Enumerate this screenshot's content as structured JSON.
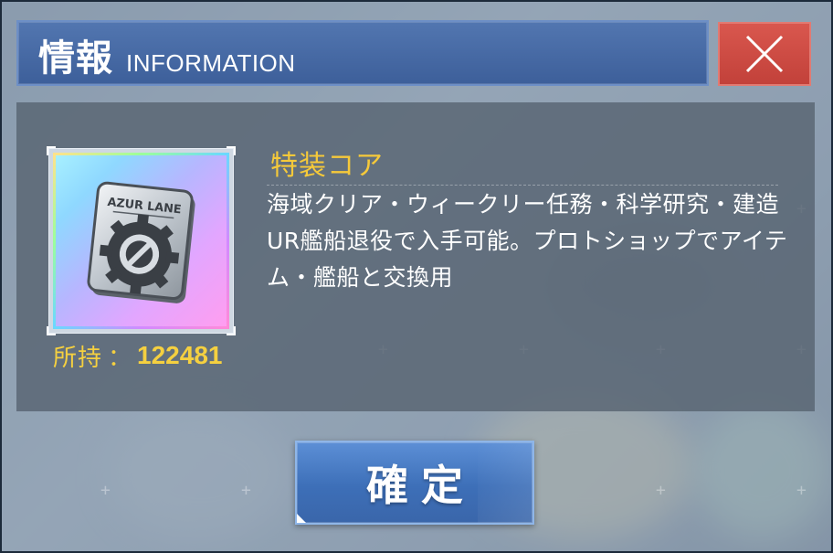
{
  "dialog": {
    "title_main": "情報",
    "title_sub": "INFORMATION"
  },
  "item": {
    "name": "特装コア",
    "description": "海域クリア・ウィークリー任務・科学研究・建造UR艦船退役で入手可能。プロトショップでアイテム・艦船と交換用",
    "owned_label": "所持",
    "owned_separator": "：",
    "owned_value": "122481",
    "icon_text": "AZUR LANE",
    "icon_name": "gear-core-icon"
  },
  "buttons": {
    "close_icon": "close-icon",
    "confirm_label": "確定"
  },
  "colors": {
    "header": "#4a6ea8",
    "close": "#cf4b43",
    "accent_yellow": "#f5c93a",
    "confirm": "#4a7fc6"
  }
}
